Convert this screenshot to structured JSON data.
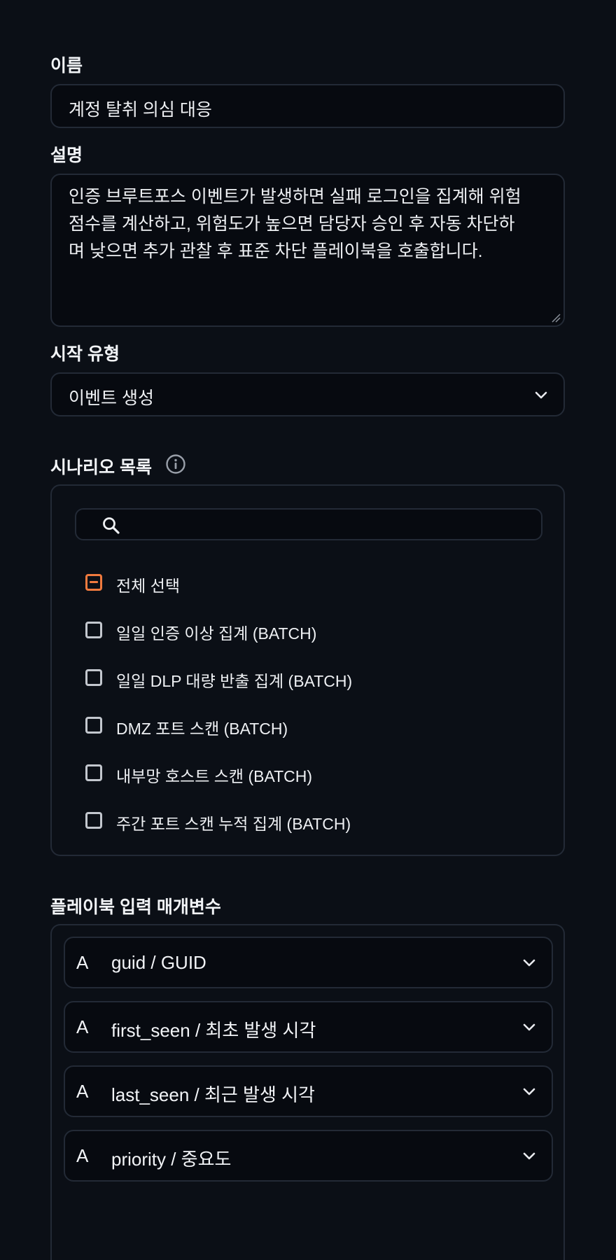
{
  "form": {
    "name_label": "이름",
    "name_value": "계정 탈취 의심 대응",
    "description_label": "설명",
    "description_value": "인증 브루트포스 이벤트가 발생하면 실패 로그인을 집계해 위험\n점수를 계산하고, 위험도가 높으면 담당자 승인 후 자동 차단하\n며 낮으면 추가 관찰 후 표준 차단 플레이북을 호출합니다.",
    "start_type_label": "시작 유형",
    "start_type_value": "이벤트 생성"
  },
  "scenarios": {
    "title": "시나리오 목록",
    "search_value": "",
    "select_all_label": "전체 선택",
    "select_all_state": "indeterminate",
    "items": [
      {
        "label": "일일 인증 이상 집계 (BATCH)",
        "checked": false
      },
      {
        "label": "일일 DLP 대량 반출 집계 (BATCH)",
        "checked": false
      },
      {
        "label": "DMZ 포트 스캔 (BATCH)",
        "checked": false
      },
      {
        "label": "내부망 호스트 스캔 (BATCH)",
        "checked": false
      },
      {
        "label": "주간 포트 스캔 누적 집계 (BATCH)",
        "checked": false
      }
    ]
  },
  "params": {
    "title": "플레이북 입력 매개변수",
    "items": [
      {
        "type": "A",
        "name": "guid / GUID"
      },
      {
        "type": "A",
        "name": "first_seen / 최초 발생 시각"
      },
      {
        "type": "A",
        "name": "last_seen / 최근 발생 시각"
      },
      {
        "type": "A",
        "name": "priority / 중요도"
      }
    ]
  },
  "colors": {
    "background": "#0b0f16",
    "border": "#232a36",
    "accent": "#f07a3e"
  }
}
